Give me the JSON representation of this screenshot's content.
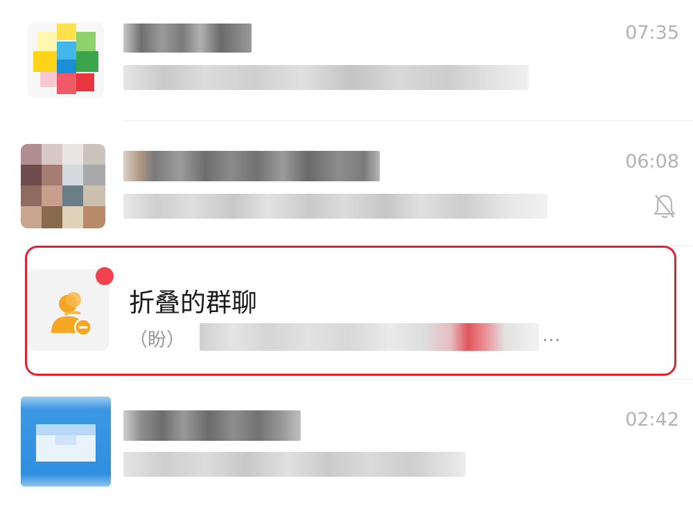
{
  "chats": [
    {
      "time": "07:35",
      "muted": false,
      "avatar_icon": "app-logo-icon"
    },
    {
      "time": "06:08",
      "muted": true,
      "avatar_icon": "group-photo-avatar"
    },
    {
      "title": "折叠的群聊",
      "preview_prefix": "（盼）",
      "preview_ellipsis": "…",
      "unread": true,
      "avatar_icon": "folded-group-icon",
      "highlighted": true
    },
    {
      "time": "02:42",
      "muted": false,
      "avatar_icon": "mail-icon"
    }
  ],
  "colors": {
    "highlight_border": "#e3202b",
    "unread_dot": "#f0434f",
    "folded_group_icon": "#f5a623",
    "mail_avatar": "#2f8fe0"
  }
}
